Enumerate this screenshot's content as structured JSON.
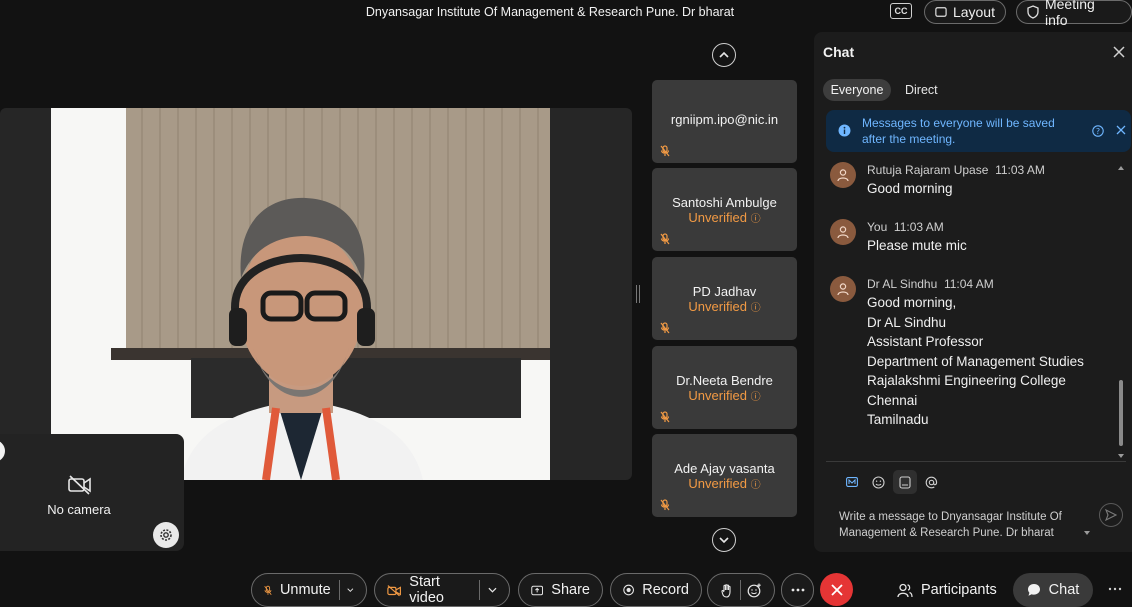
{
  "header": {
    "meeting_title": "Dnyansagar Institute Of Management & Research Pune. Dr bharat",
    "cc_label": "CC",
    "layout_label": "Layout",
    "meeting_info_label": "Meeting info"
  },
  "selfview": {
    "no_camera_label": "No camera"
  },
  "participants_strip": [
    {
      "name": "rgniipm.ipo@nic.in",
      "status": ""
    },
    {
      "name": "Santoshi Ambulge",
      "status": "Unverified"
    },
    {
      "name": "PD Jadhav",
      "status": "Unverified"
    },
    {
      "name": "Dr.Neeta Bendre",
      "status": "Unverified"
    },
    {
      "name": "Ade Ajay vasanta",
      "status": "Unverified"
    }
  ],
  "chat": {
    "title": "Chat",
    "tabs": [
      "Everyone",
      "Direct"
    ],
    "notice": "Messages to everyone will be saved after the meeting.",
    "messages": [
      {
        "sender": "Rutuja Rajaram Upase",
        "time": "11:03 AM",
        "lines": [
          "Good morning"
        ]
      },
      {
        "sender": "You",
        "time": "11:03 AM",
        "lines": [
          "Please mute mic"
        ]
      },
      {
        "sender": "Dr AL Sindhu",
        "time": "11:04 AM",
        "lines": [
          "Good morning,",
          "Dr AL Sindhu",
          "Assistant Professor",
          "Department of Management Studies",
          "Rajalakshmi Engineering College",
          "Chennai",
          "Tamilnadu"
        ]
      }
    ],
    "composer_placeholder": "Write a message to Dnyansagar Institute Of Management & Research Pune. Dr bharat"
  },
  "toolbar": {
    "unmute_label": "Unmute",
    "start_video_label": "Start video",
    "share_label": "Share",
    "record_label": "Record",
    "participants_label": "Participants",
    "chat_label": "Chat"
  },
  "colors": {
    "background": "#121212",
    "unverified": "#f29a44",
    "end_call": "#e53535",
    "notice_bg": "#0f2a44",
    "notice_text": "#6fb6ff",
    "avatar": "#8a5a3e"
  }
}
